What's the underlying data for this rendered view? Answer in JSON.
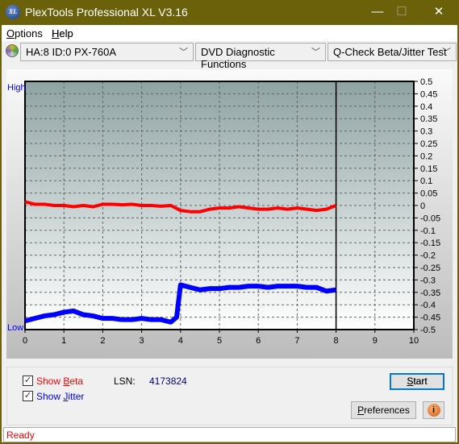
{
  "window": {
    "title": "PlexTools Professional XL V3.16",
    "logo_text": "XL",
    "minimize": "—",
    "maximize": "☐",
    "close": "✕"
  },
  "menu": [
    {
      "label": "Options",
      "u": "O",
      "rest": "ptions"
    },
    {
      "label": "Help",
      "u": "H",
      "rest": "elp"
    }
  ],
  "toolbar": {
    "drive": "HA:8 ID:0  PX-760A",
    "function": "DVD Diagnostic Functions",
    "test": "Q-Check Beta/Jitter Test"
  },
  "chart_data": {
    "type": "line",
    "left_label_high": "High",
    "left_label_low": "Low",
    "xlim": [
      0,
      10
    ],
    "ylim": [
      -0.5,
      0.5
    ],
    "x_ticks": [
      "0",
      "1",
      "2",
      "3",
      "4",
      "5",
      "6",
      "7",
      "8",
      "9",
      "10"
    ],
    "y_ticks": [
      "0.5",
      "0.45",
      "0.4",
      "0.35",
      "0.3",
      "0.25",
      "0.2",
      "0.15",
      "0.1",
      "0.05",
      "0",
      "-0.05",
      "-0.1",
      "-0.15",
      "-0.2",
      "-0.25",
      "-0.3",
      "-0.35",
      "-0.4",
      "-0.45",
      "-0.5"
    ],
    "grid": true,
    "end_marker_x": 8,
    "series": [
      {
        "name": "Beta",
        "color": "#ff0000",
        "x": [
          0,
          0.25,
          0.5,
          0.75,
          1,
          1.25,
          1.5,
          1.75,
          2,
          2.25,
          2.5,
          2.75,
          3,
          3.25,
          3.5,
          3.75,
          4,
          4.25,
          4.5,
          4.75,
          5,
          5.25,
          5.5,
          5.75,
          6,
          6.25,
          6.5,
          6.75,
          7,
          7.25,
          7.5,
          7.75,
          8
        ],
        "y": [
          0.015,
          0.005,
          0.005,
          0,
          0,
          -0.005,
          0,
          -0.005,
          0.005,
          0.005,
          0.003,
          0.005,
          0,
          0,
          -0.003,
          0,
          -0.02,
          -0.025,
          -0.025,
          -0.015,
          -0.01,
          -0.01,
          -0.005,
          -0.01,
          -0.015,
          -0.015,
          -0.01,
          -0.015,
          -0.01,
          -0.015,
          -0.02,
          -0.015,
          0
        ]
      },
      {
        "name": "Jitter",
        "color": "#0000ff",
        "x": [
          0,
          0.25,
          0.5,
          0.75,
          1,
          1.25,
          1.5,
          1.75,
          2,
          2.25,
          2.5,
          2.75,
          3,
          3.25,
          3.5,
          3.75,
          3.9,
          4,
          4.25,
          4.5,
          4.75,
          5,
          5.25,
          5.5,
          5.75,
          6,
          6.25,
          6.5,
          6.75,
          7,
          7.25,
          7.5,
          7.75,
          8
        ],
        "y": [
          -0.465,
          -0.455,
          -0.445,
          -0.44,
          -0.43,
          -0.425,
          -0.44,
          -0.445,
          -0.455,
          -0.455,
          -0.46,
          -0.46,
          -0.455,
          -0.46,
          -0.46,
          -0.47,
          -0.45,
          -0.32,
          -0.33,
          -0.34,
          -0.335,
          -0.335,
          -0.33,
          -0.33,
          -0.325,
          -0.325,
          -0.33,
          -0.325,
          -0.325,
          -0.325,
          -0.33,
          -0.33,
          -0.345,
          -0.34
        ]
      }
    ]
  },
  "controls": {
    "show_beta": "Show Beta",
    "beta_u": "B",
    "beta_pre": "Show ",
    "beta_rest": "eta",
    "show_jitter": "Show Jitter",
    "jitter_pre": "Show ",
    "jitter_u": "J",
    "jitter_rest": "itter",
    "beta_checked": true,
    "jitter_checked": true,
    "lsn_label": "LSN:",
    "lsn_value": "4173824",
    "start": "Start",
    "start_u": "S",
    "start_rest": "tart",
    "preferences": "Preferences",
    "pref_u": "P",
    "pref_rest": "references",
    "info_icon": "i"
  },
  "status": {
    "text": "Ready"
  }
}
